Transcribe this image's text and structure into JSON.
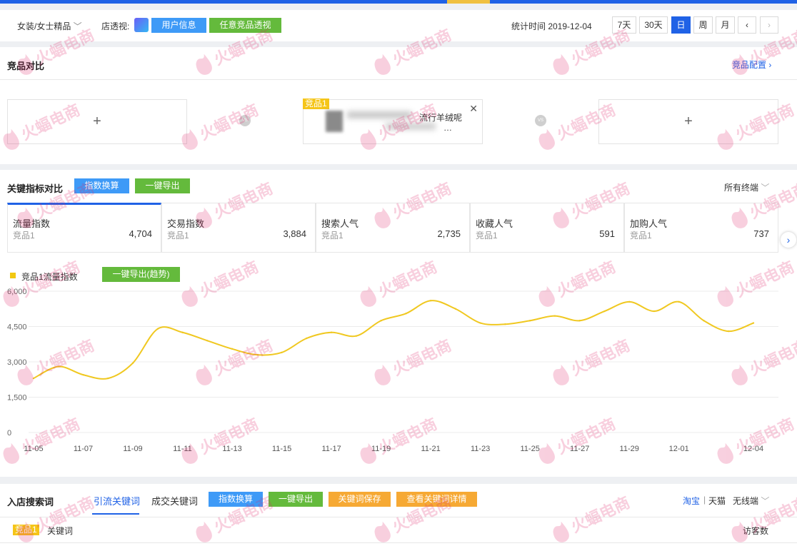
{
  "filter": {
    "category": "女装/女士精品",
    "shop_label": "店透视:",
    "btn_user_info": "用户信息",
    "btn_competitor": "任意竞品透视",
    "stat_time": "统计时间 2019-12-04",
    "periods": [
      "7天",
      "30天",
      "日",
      "周",
      "月"
    ],
    "active_period": "日"
  },
  "compare": {
    "title": "竞品对比",
    "config_link": "竞品配置",
    "slot_tag": "竞品1",
    "slot_text_line1": "流行羊绒呢",
    "slot_text_line2": "…",
    "vs": "VS"
  },
  "metrics_section": {
    "title": "关键指标对比",
    "btn_index": "指数换算",
    "btn_export": "一键导出",
    "terminal": "所有终端",
    "items": [
      {
        "label": "流量指数",
        "sub": "竞品1",
        "value": "4,704"
      },
      {
        "label": "交易指数",
        "sub": "竞品1",
        "value": "3,884"
      },
      {
        "label": "搜索人气",
        "sub": "竞品1",
        "value": "2,735"
      },
      {
        "label": "收藏人气",
        "sub": "竞品1",
        "value": "591"
      },
      {
        "label": "加购人气",
        "sub": "竞品1",
        "value": "737"
      }
    ],
    "legend": "竞品1流量指数",
    "btn_export_trend": "一键导出(趋势)"
  },
  "chart_data": {
    "type": "line",
    "series": [
      {
        "name": "竞品1流量指数",
        "color": "#f0c820",
        "values": [
          2300,
          2800,
          2450,
          2300,
          2950,
          4400,
          4250,
          3900,
          3550,
          3300,
          3400,
          4000,
          4250,
          4100,
          4750,
          5050,
          5600,
          5250,
          4650,
          4600,
          4750,
          4950,
          4750,
          5150,
          5550,
          5150,
          5550,
          4750,
          4300,
          4650
        ]
      }
    ],
    "x_ticks": [
      "11-05",
      "11-07",
      "11-09",
      "11-11",
      "11-13",
      "11-15",
      "11-17",
      "11-19",
      "11-21",
      "11-23",
      "11-25",
      "11-27",
      "11-29",
      "12-01",
      "12-04"
    ],
    "y_ticks": [
      "0",
      "1,500",
      "3,000",
      "4,500",
      "6,000"
    ],
    "ylim": [
      0,
      6000
    ],
    "grid": true
  },
  "search_section": {
    "title": "入店搜索词",
    "tabs": [
      "引流关键词",
      "成交关键词"
    ],
    "btn_index": "指数换算",
    "btn_export": "一键导出",
    "btn_save": "关键词保存",
    "btn_detail": "查看关键词详情",
    "platform_taobao": "淘宝",
    "platform_sep": "|",
    "platform_tmall": "天猫",
    "terminal": "无线端",
    "col_tag": "竞品1",
    "col_keyword": "关键词",
    "col_visitors": "访客数"
  },
  "watermark": "火蝠电商"
}
